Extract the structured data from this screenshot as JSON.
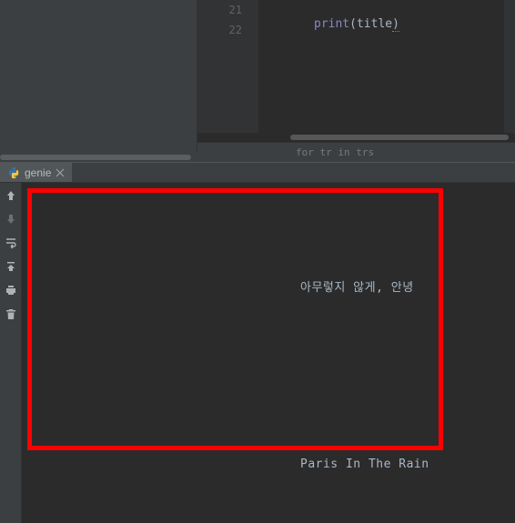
{
  "editor": {
    "gutter": {
      "l21": "21",
      "l22": "22"
    },
    "code": {
      "print_kw": "print",
      "paren_open": "(",
      "title_ident": "title",
      "paren_close": ")"
    },
    "fold_glyph": "⊖"
  },
  "breadcrumbs": {
    "text": "for tr in trs"
  },
  "run": {
    "tab": {
      "label": "genie"
    },
    "toolbar": {
      "up": "arrow-up",
      "down": "arrow-down",
      "wrap": "soft-wrap",
      "scroll_end": "scroll-to-end",
      "print": "print",
      "delete": "trash"
    },
    "console": {
      "line1": "아무렇지 않게, 안녕",
      "line2": "Paris In The Rain"
    }
  }
}
